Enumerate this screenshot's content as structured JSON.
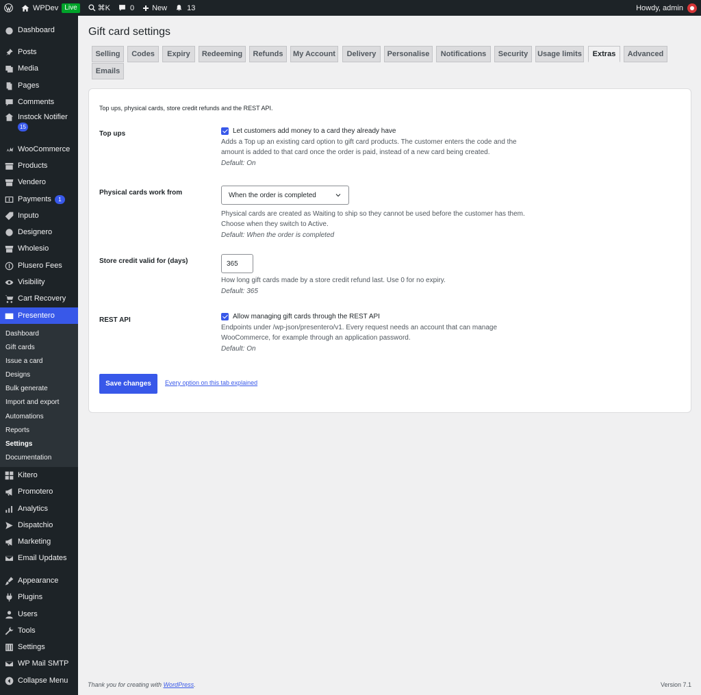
{
  "adminbar": {
    "site_name": "WPDev",
    "live_badge": "Live",
    "shortcut": "⌘K",
    "comments_count": "0",
    "new_label": "New",
    "notifications_count": "13",
    "greeting": "Howdy, admin"
  },
  "sidebar": {
    "dashboard": "Dashboard",
    "posts": "Posts",
    "media": "Media",
    "pages": "Pages",
    "comments": "Comments",
    "instock_notifier": "Instock Notifier",
    "instock_badge": "15",
    "woocommerce": "WooCommerce",
    "products": "Products",
    "vendero": "Vendero",
    "payments": "Payments",
    "payments_badge": "1",
    "inputo": "Inputo",
    "designero": "Designero",
    "wholesio": "Wholesio",
    "plusero_fees": "Plusero Fees",
    "visibility": "Visibility",
    "cart_recovery": "Cart Recovery",
    "presentero": "Presentero",
    "submenu": [
      "Dashboard",
      "Gift cards",
      "Issue a card",
      "Designs",
      "Bulk generate",
      "Import and export",
      "Automations",
      "Reports",
      "Settings",
      "Documentation"
    ],
    "kitero": "Kitero",
    "promotero": "Promotero",
    "analytics": "Analytics",
    "dispatchio": "Dispatchio",
    "marketing": "Marketing",
    "email_updates": "Email Updates",
    "appearance": "Appearance",
    "plugins": "Plugins",
    "users": "Users",
    "tools": "Tools",
    "settings": "Settings",
    "wp_mail_smtp": "WP Mail SMTP",
    "collapse": "Collapse Menu"
  },
  "page": {
    "title": "Gift card settings",
    "tabs": [
      "Selling",
      "Codes",
      "Expiry",
      "Redeeming",
      "Refunds",
      "My Account",
      "Delivery",
      "Personalise",
      "Notifications",
      "Security",
      "Usage limits",
      "Extras",
      "Advanced",
      "Emails"
    ],
    "active_tab": "Extras",
    "intro": "Top ups, physical cards, store credit refunds and the REST API.",
    "topups": {
      "label": "Top ups",
      "checkbox": "Let customers add money to a card they already have",
      "desc": "Adds a Top up an existing card option to gift card products. The customer enters the code and the amount is added to that card once the order is paid, instead of a new card being created.",
      "default": "Default: On"
    },
    "physical": {
      "label": "Physical cards work from",
      "selected": "When the order is completed",
      "desc": "Physical cards are created as Waiting to ship so they cannot be used before the customer has them. Choose when they switch to Active.",
      "default": "Default: When the order is completed"
    },
    "store_credit": {
      "label": "Store credit valid for (days)",
      "value": "365",
      "desc": "How long gift cards made by a store credit refund last. Use 0 for no expiry.",
      "default": "Default: 365"
    },
    "rest_api": {
      "label": "REST API",
      "checkbox": "Allow managing gift cards through the REST API",
      "desc": "Endpoints under /wp-json/presentero/v1. Every request needs an account that can manage WooCommerce, for example through an application password.",
      "default": "Default: On"
    },
    "save_label": "Save changes",
    "help_link": "Every option on this tab explained"
  },
  "footer": {
    "thanks_prefix": "Thank you for creating with ",
    "thanks_link": "WordPress",
    "thanks_suffix": ".",
    "version": "Version 7.1"
  },
  "colors": {
    "accent": "#3858e9",
    "sidebar_bg": "#1d2327",
    "submenu_bg": "#2c3338",
    "page_bg": "#f0f0f1"
  }
}
